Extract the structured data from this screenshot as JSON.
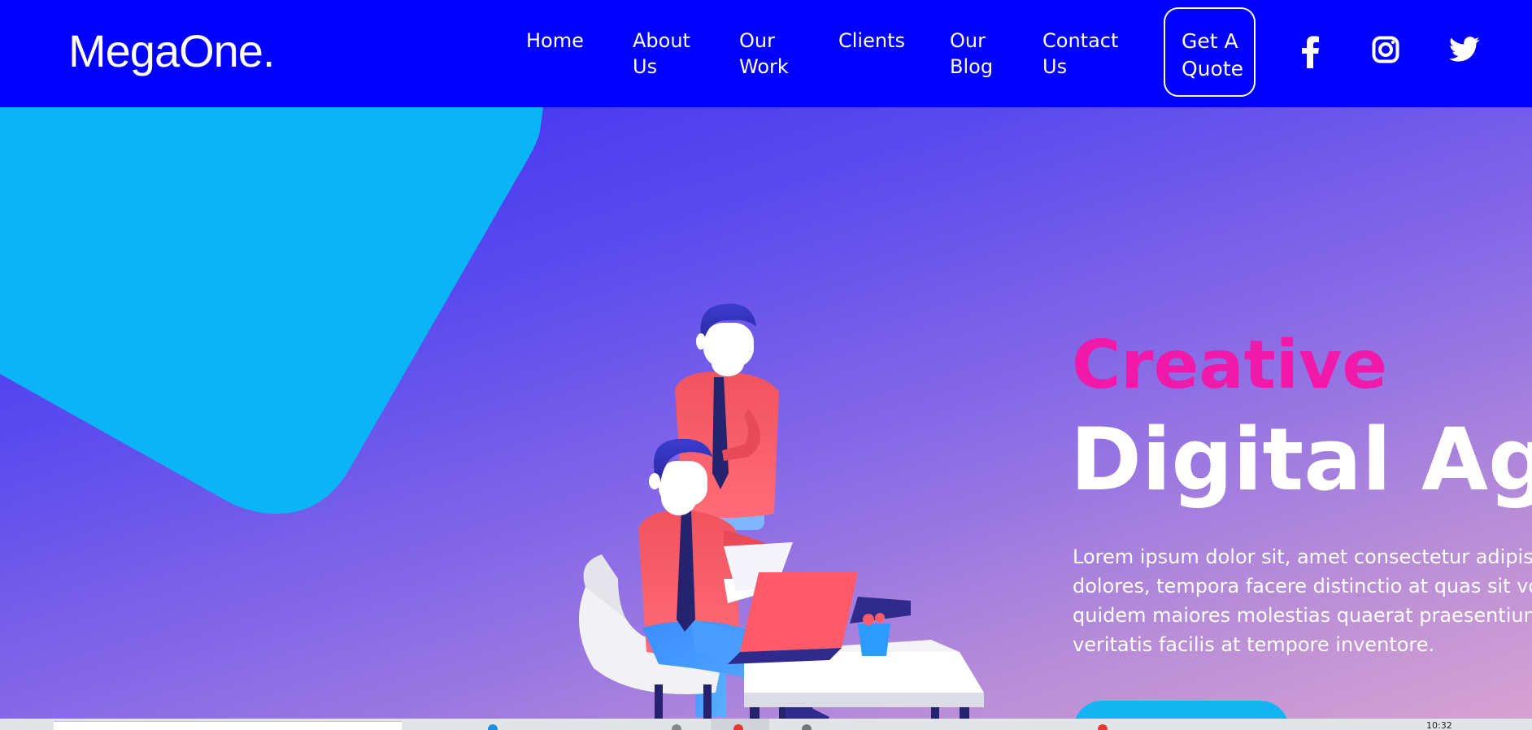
{
  "brand": "MegaOne.",
  "nav": {
    "home": "Home",
    "about_line1": "About",
    "about_line2": "Us",
    "work_line1": "Our",
    "work_line2": "Work",
    "clients": "Clients",
    "blog_line1": "Our",
    "blog_line2": "Blog",
    "contact_line1": "Contact",
    "contact_line2": "Us",
    "quote_line1": "Get A",
    "quote_line2": "Quote"
  },
  "social": [
    "facebook-icon",
    "instagram-icon",
    "twitter-icon"
  ],
  "hero": {
    "eyebrow": "Creative",
    "headline": "Digital Age",
    "description": [
      "Lorem ipsum dolor sit, amet consectetur adipisi",
      "dolores, tempora facere distinctio at quas sit vo",
      "quidem maiores molestias quaerat praesentium",
      "veritatis facilis at tempore inventore."
    ],
    "cta_color": "#12b4f2"
  },
  "taskbar": {
    "clock": "10:32"
  },
  "colors": {
    "nav_bg": "#0000ff",
    "accent_pink": "#f019a9",
    "blob_cyan": "#0ab4f6"
  }
}
